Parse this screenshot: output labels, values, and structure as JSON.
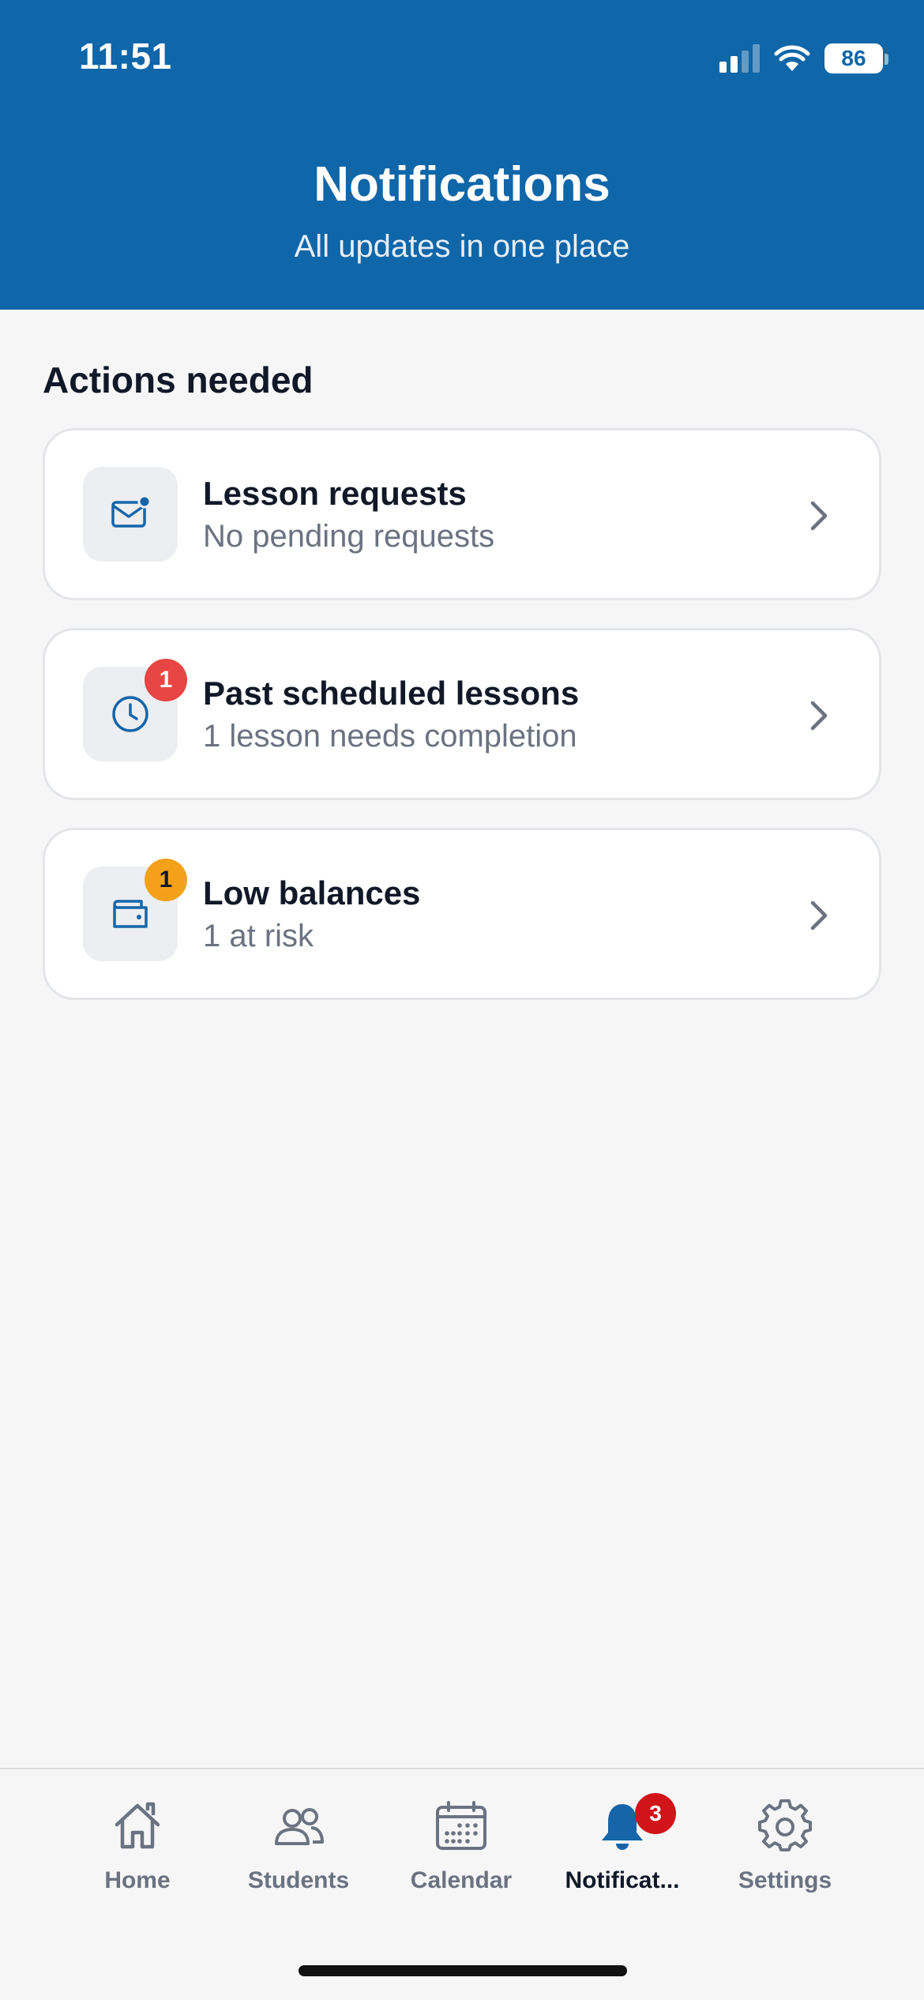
{
  "status_bar": {
    "time": "11:51",
    "battery": "86"
  },
  "header": {
    "title": "Notifications",
    "subtitle": "All updates in one place",
    "background_color": "#0f66a8"
  },
  "section": {
    "title": "Actions needed"
  },
  "cards": [
    {
      "title": "Lesson requests",
      "subtitle": "No pending requests",
      "icon": "mail-icon",
      "badge": ""
    },
    {
      "title": "Past scheduled lessons",
      "subtitle": "1 lesson needs completion",
      "icon": "clock-icon",
      "badge": "1",
      "badge_color": "#e84545"
    },
    {
      "title": "Low balances",
      "subtitle": "1 at risk",
      "icon": "wallet-icon",
      "badge": "1",
      "badge_color": "#f4a11a"
    }
  ],
  "tabbar": {
    "tabs": [
      {
        "label": "Home",
        "icon": "house-icon"
      },
      {
        "label": "Students",
        "icon": "people-icon"
      },
      {
        "label": "Calendar",
        "icon": "calendar-icon"
      },
      {
        "label": "Notificat...",
        "icon": "bell-icon",
        "badge": "3",
        "active": true
      },
      {
        "label": "Settings",
        "icon": "gear-icon"
      }
    ]
  }
}
